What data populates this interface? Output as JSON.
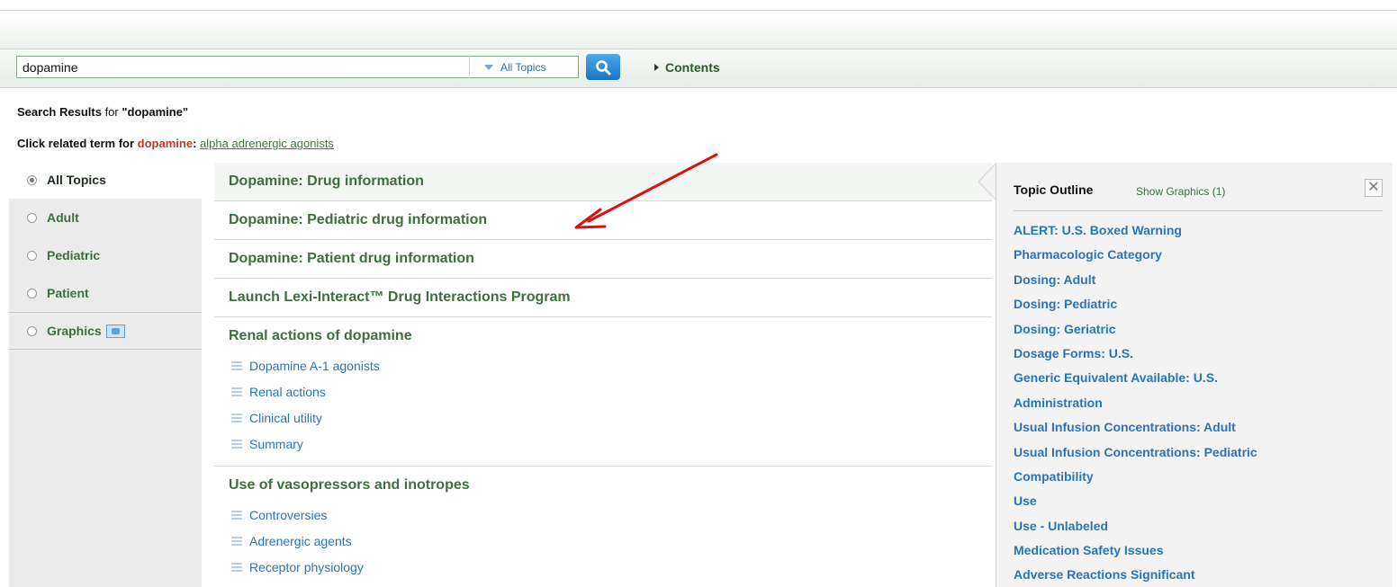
{
  "search": {
    "query": "dopamine",
    "scope_label": "All Topics",
    "contents_label": "Contents"
  },
  "results_heading": {
    "label": "Search Results",
    "for_word": "for",
    "query_quoted": "\"dopamine\""
  },
  "related": {
    "prefix": "Click related term for",
    "term": "dopamine",
    "colon": ":",
    "link": "alpha adrenergic agonists"
  },
  "sidebar": {
    "items": [
      {
        "label": "All Topics",
        "selected": true
      },
      {
        "label": "Adult",
        "selected": false
      },
      {
        "label": "Pediatric",
        "selected": false
      },
      {
        "label": "Patient",
        "selected": false
      },
      {
        "label": "Graphics",
        "selected": false
      }
    ]
  },
  "results": {
    "single": [
      "Dopamine: Drug information",
      "Dopamine: Pediatric drug information",
      "Dopamine: Patient drug information",
      "Launch Lexi-Interact™ Drug Interactions Program"
    ],
    "groups": [
      {
        "title": "Renal actions of dopamine",
        "sections": [
          "Dopamine A-1 agonists",
          "Renal actions",
          "Clinical utility",
          "Summary"
        ]
      },
      {
        "title": "Use of vasopressors and inotropes",
        "sections": [
          "Controversies",
          "Adrenergic agents",
          "Receptor physiology"
        ]
      }
    ]
  },
  "outline": {
    "title": "Topic Outline",
    "show_graphics": "Show Graphics (1)",
    "close_glyph": "✕",
    "items": [
      "ALERT: U.S. Boxed Warning",
      "Pharmacologic Category",
      "Dosing: Adult",
      "Dosing: Pediatric",
      "Dosing: Geriatric",
      "Dosage Forms: U.S.",
      "Generic Equivalent Available: U.S.",
      "Administration",
      "Usual Infusion Concentrations: Adult",
      "Usual Infusion Concentrations: Pediatric",
      "Compatibility",
      "Use",
      "Use - Unlabeled",
      "Medication Safety Issues",
      "Adverse Reactions Significant"
    ]
  },
  "colors": {
    "accent_green": "#3f6e3f",
    "link_blue": "#2a74b8",
    "annotation_red": "#e01010"
  }
}
